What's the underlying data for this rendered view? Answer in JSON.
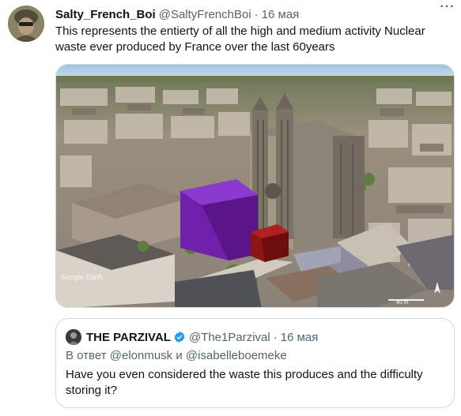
{
  "tweet": {
    "author_name": "Salty_French_Boi",
    "handle": "@SaltyFrenchBoi",
    "separator": "·",
    "date": "16 мая",
    "more_glyph": "···",
    "text": "This represents the entierty of all the high and medium activity Nuclear waste ever produced by France over the last 60years",
    "avatar_icon": "soldier-avatar",
    "media": {
      "watermark": "Google Earth",
      "scale_label": "40 m",
      "cube_colors": {
        "high": "#7a1fb8",
        "medium": "#8f1414"
      }
    }
  },
  "quote": {
    "author_name": "THE PARZIVAL",
    "verified_icon": "verified-badge-icon",
    "verified_color": "#1d9bf0",
    "handle": "@The1Parzival",
    "separator": "·",
    "date": "16 мая",
    "reply_prefix": "В ответ",
    "mention_1": "@elonmusk",
    "conjunction": "и",
    "mention_2": "@isabelleboemeke",
    "text": "Have you even considered the waste this produces and the difficulty storing it?"
  }
}
